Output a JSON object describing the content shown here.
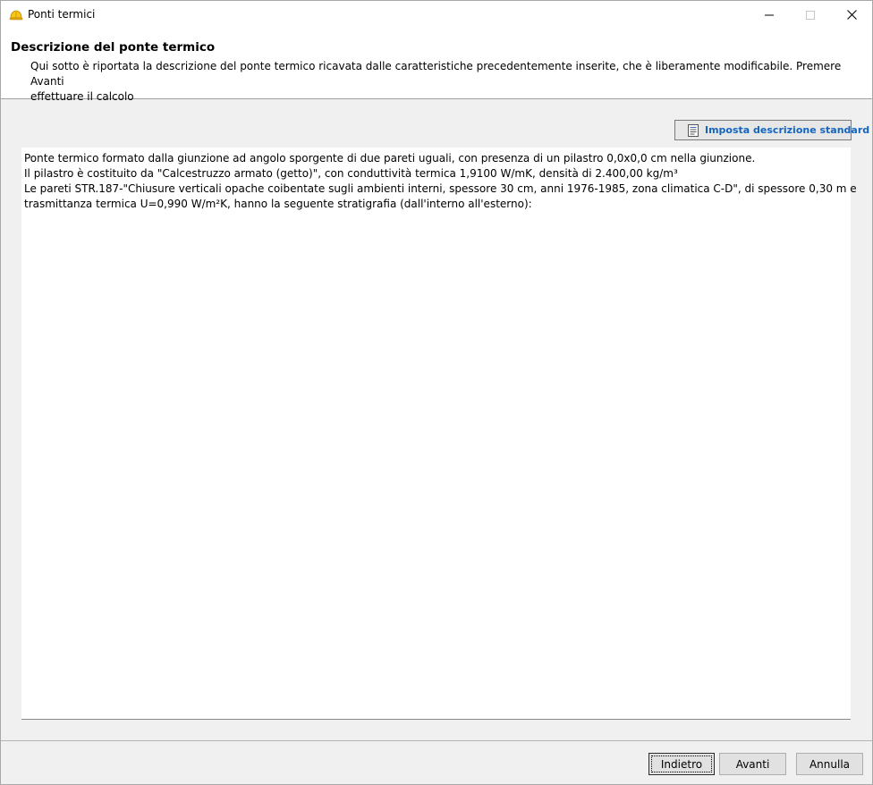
{
  "window": {
    "title": "Ponti termici",
    "icon": "hardhat-icon"
  },
  "header": {
    "title": "Descrizione del ponte termico",
    "description_line1": "Qui sotto è riportata la descrizione del ponte termico ricavata dalle caratteristiche precedentemente inserite, che è liberamente modificabile. Premere Avanti",
    "description_line2": "effettuare il calcolo"
  },
  "toolbar": {
    "standard_description_label": "Imposta descrizione standard",
    "standard_description_icon": "document-icon"
  },
  "description_text": {
    "lines": [
      "Ponte termico formato dalla giunzione ad angolo sporgente di due pareti uguali, con presenza di un pilastro 0,0x0,0 cm nella giunzione.",
      "Il pilastro è costituito da \"Calcestruzzo armato (getto)\", con conduttività termica 1,9100 W/mK, densità di 2.400,00 kg/m³",
      "Le pareti STR.187-\"Chiusure verticali opache coibentate sugli ambienti interni, spessore 30 cm, anni 1976-1985, zona climatica C-D\", di spessore 0,30 m e",
      "trasmittanza termica U=0,990 W/m²K, hanno la seguente stratigrafia (dall'interno all'esterno):"
    ]
  },
  "footer": {
    "back_label": "Indietro",
    "next_label": "Avanti",
    "cancel_label": "Annulla"
  }
}
